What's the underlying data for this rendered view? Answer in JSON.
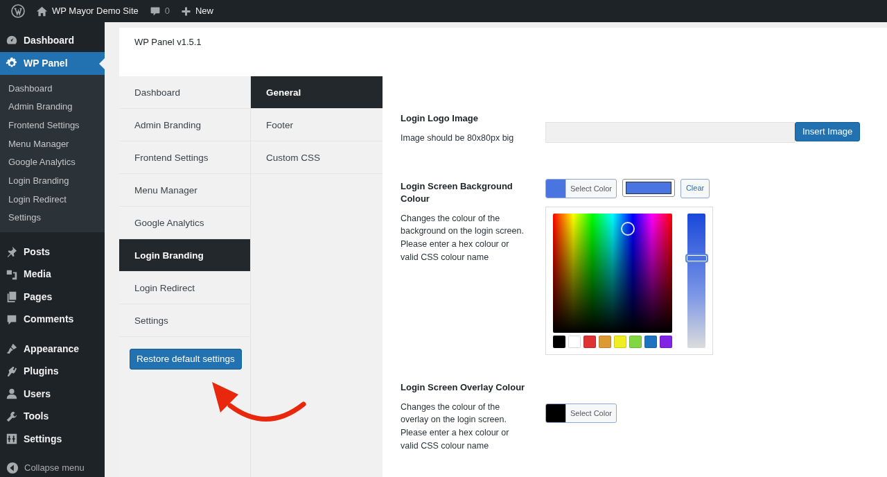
{
  "admin_bar": {
    "site_name": "WP Mayor Demo Site",
    "comments_count": "0",
    "new_label": "New"
  },
  "sidebar": {
    "groups": [
      [
        {
          "label": "Dashboard",
          "selected": false
        },
        {
          "label": "WP Panel",
          "selected": true,
          "submenu": [
            {
              "label": "Dashboard",
              "selected": false
            },
            {
              "label": "Admin Branding",
              "selected": false
            },
            {
              "label": "Frontend Settings",
              "selected": false
            },
            {
              "label": "Menu Manager",
              "selected": false
            },
            {
              "label": "Google Analytics",
              "selected": false
            },
            {
              "label": "Login Branding",
              "selected": false
            },
            {
              "label": "Login Redirect",
              "selected": false
            },
            {
              "label": "Settings",
              "selected": false
            }
          ]
        }
      ],
      [
        {
          "label": "Posts",
          "selected": false
        },
        {
          "label": "Media",
          "selected": false
        },
        {
          "label": "Pages",
          "selected": false
        },
        {
          "label": "Comments",
          "selected": false
        }
      ],
      [
        {
          "label": "Appearance",
          "selected": false
        },
        {
          "label": "Plugins",
          "selected": false
        },
        {
          "label": "Users",
          "selected": false
        },
        {
          "label": "Tools",
          "selected": false
        },
        {
          "label": "Settings",
          "selected": false
        }
      ]
    ],
    "collapse_label": "Collapse menu"
  },
  "panel": {
    "title": "WP Panel v1.5.1",
    "tabs": [
      {
        "label": "Dashboard",
        "selected": false
      },
      {
        "label": "Admin Branding",
        "selected": false
      },
      {
        "label": "Frontend Settings",
        "selected": false
      },
      {
        "label": "Menu Manager",
        "selected": false
      },
      {
        "label": "Google Analytics",
        "selected": false
      },
      {
        "label": "Login Branding",
        "selected": true
      },
      {
        "label": "Login Redirect",
        "selected": false
      },
      {
        "label": "Settings",
        "selected": false
      }
    ],
    "restore_button": "Restore default settings",
    "subtabs": [
      {
        "label": "General",
        "selected": true
      },
      {
        "label": "Footer",
        "selected": false
      },
      {
        "label": "Custom CSS",
        "selected": false
      }
    ],
    "fields": [
      {
        "kind": "image",
        "title": "Login Logo Image",
        "description": "Image should be 80x80px big",
        "button": "Insert Image"
      },
      {
        "kind": "color",
        "title": "Login Screen Background Colour",
        "description": "Changes the colour of the background on the login screen. Please enter a hex colour or valid CSS colour name",
        "color": "#4a74e0",
        "select_label": "Select Color",
        "clear_label": "Clear",
        "picker": {
          "level": 0.67,
          "swatches": [
            {
              "color": "#000000"
            },
            {
              "color": "#ffffff"
            },
            {
              "color": "#dd3333"
            },
            {
              "color": "#dd9933"
            },
            {
              "color": "#eeee22"
            },
            {
              "color": "#81d742"
            },
            {
              "color": "#1e73be"
            },
            {
              "color": "#8224e3"
            }
          ]
        }
      },
      {
        "kind": "color",
        "title": "Login Screen Overlay Colour",
        "description": "Changes the colour of the overlay on the login screen. Please enter a hex colour or valid CSS colour name",
        "color": "#000000",
        "select_label": "Select Color"
      }
    ]
  }
}
